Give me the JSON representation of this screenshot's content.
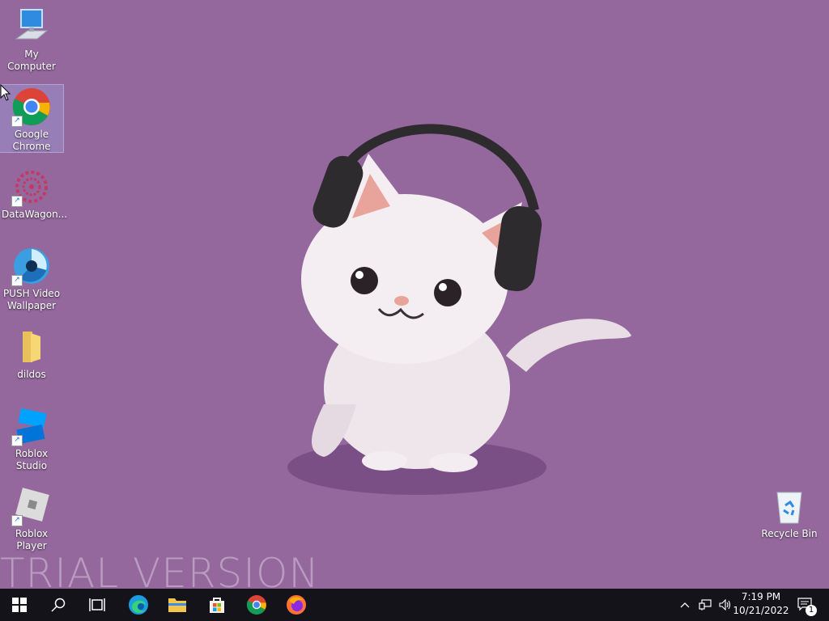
{
  "desktop": {
    "icons": [
      {
        "label": "My Computer"
      },
      {
        "label": "Google Chrome"
      },
      {
        "label": "DataWagon..."
      },
      {
        "label": "PUSH Video Wallpaper"
      },
      {
        "label": "dildos"
      },
      {
        "label": "Roblox Studio"
      },
      {
        "label": "Roblox Player"
      },
      {
        "label": "Recycle Bin"
      }
    ],
    "watermark": "TRIAL VERSION"
  },
  "taskbar": {
    "time": "7:19 PM",
    "date": "10/21/2022",
    "notification_count": "1"
  },
  "colors": {
    "wallpaper": "#94689d",
    "taskbar": "#14131a"
  }
}
